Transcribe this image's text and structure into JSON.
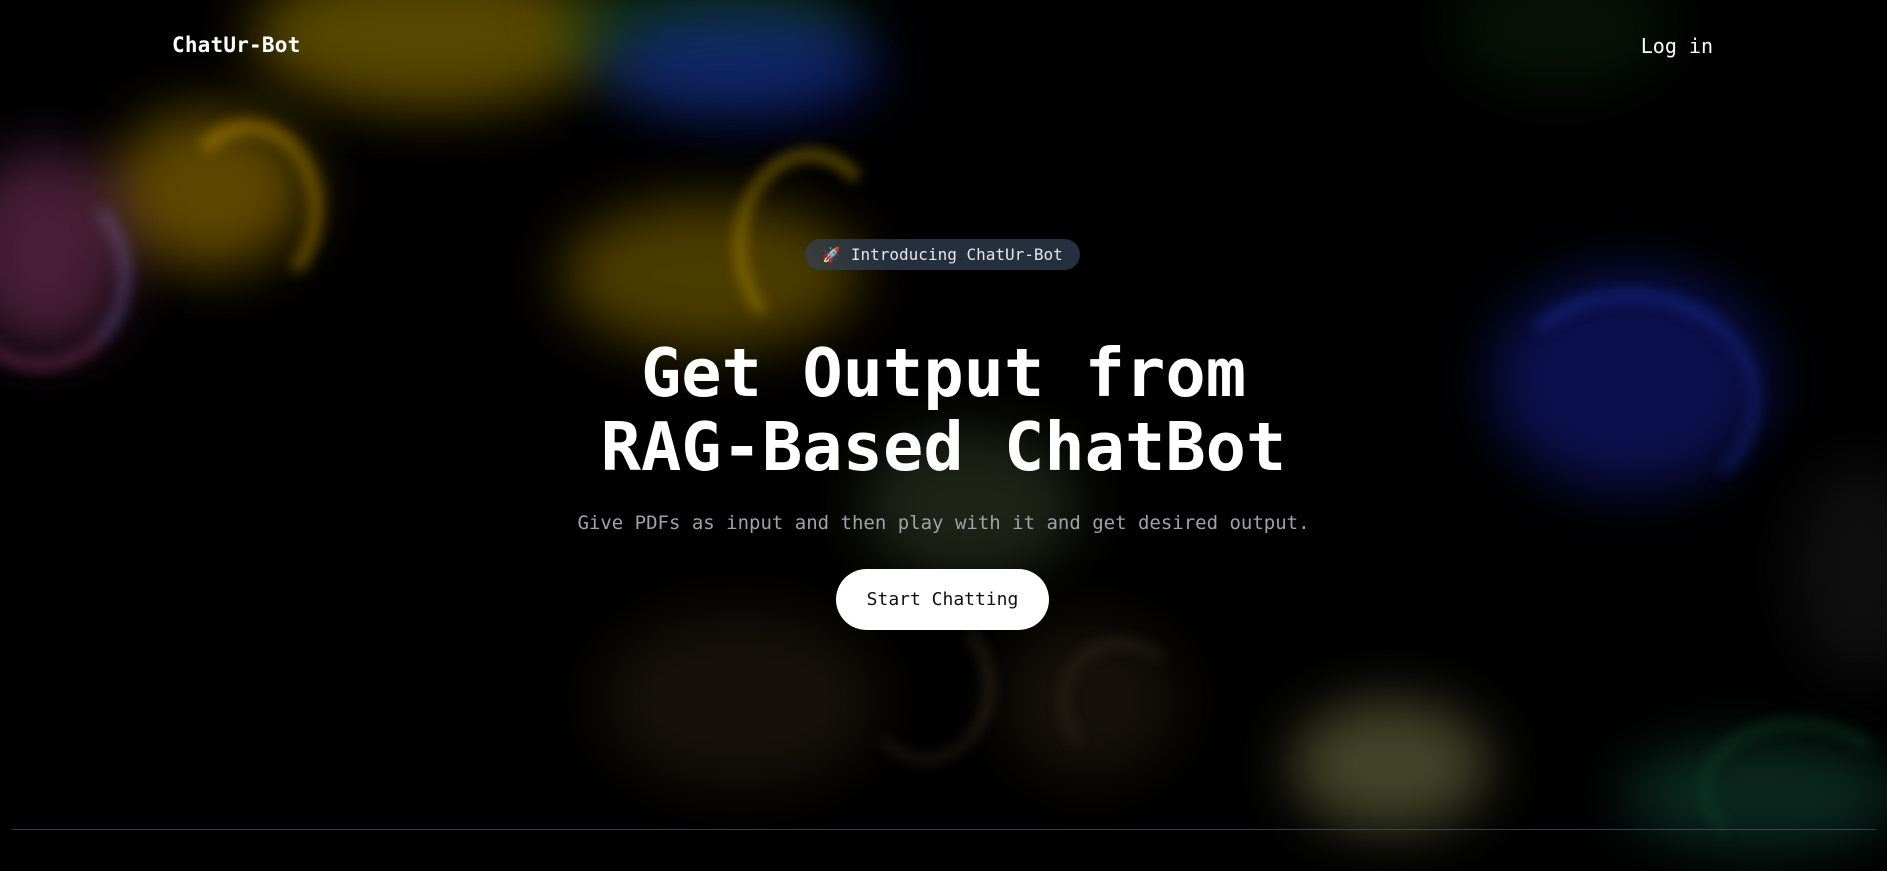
{
  "header": {
    "brand": "ChatUr-Bot",
    "login_label": "Log in"
  },
  "hero": {
    "badge_icon": "rocket-icon",
    "badge_icon_glyph": "🚀",
    "badge_text": "Introducing ChatUr-Bot",
    "title_line1": "Get Output from",
    "title_line2": "RAG-Based ChatBot",
    "subtitle": "Give PDFs as input and then play with it and get desired output.",
    "cta_label": "Start Chatting"
  },
  "colors": {
    "background": "#000000",
    "text": "#ffffff",
    "subtitle": "#a1a1aa",
    "badge_bg": "#334155",
    "button_bg": "#ffffff",
    "button_text": "#111111"
  }
}
